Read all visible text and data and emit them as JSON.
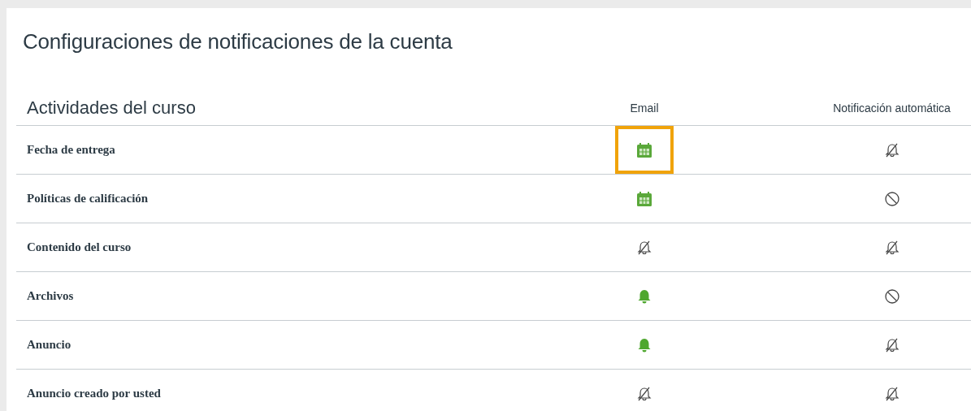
{
  "title": "Configuraciones de notificaciones de la cuenta",
  "table": {
    "columns": [
      "Actividades del curso",
      "Email",
      "Notificación automática"
    ],
    "rows": [
      {
        "name": "Fecha de entrega",
        "email": {
          "kind": "daily",
          "highlighted": true
        },
        "push": {
          "kind": "off",
          "highlighted": false
        }
      },
      {
        "name": "Políticas de calificación",
        "email": {
          "kind": "daily",
          "highlighted": false
        },
        "push": {
          "kind": "never",
          "highlighted": false
        }
      },
      {
        "name": "Contenido del curso",
        "email": {
          "kind": "off",
          "highlighted": false
        },
        "push": {
          "kind": "off",
          "highlighted": false
        }
      },
      {
        "name": "Archivos",
        "email": {
          "kind": "immediate",
          "highlighted": false
        },
        "push": {
          "kind": "never",
          "highlighted": false
        }
      },
      {
        "name": "Anuncio",
        "email": {
          "kind": "immediate",
          "highlighted": false
        },
        "push": {
          "kind": "off",
          "highlighted": false
        }
      },
      {
        "name": "Anuncio creado por usted",
        "email": {
          "kind": "off",
          "highlighted": false
        },
        "push": {
          "kind": "off",
          "highlighted": false
        }
      }
    ]
  }
}
